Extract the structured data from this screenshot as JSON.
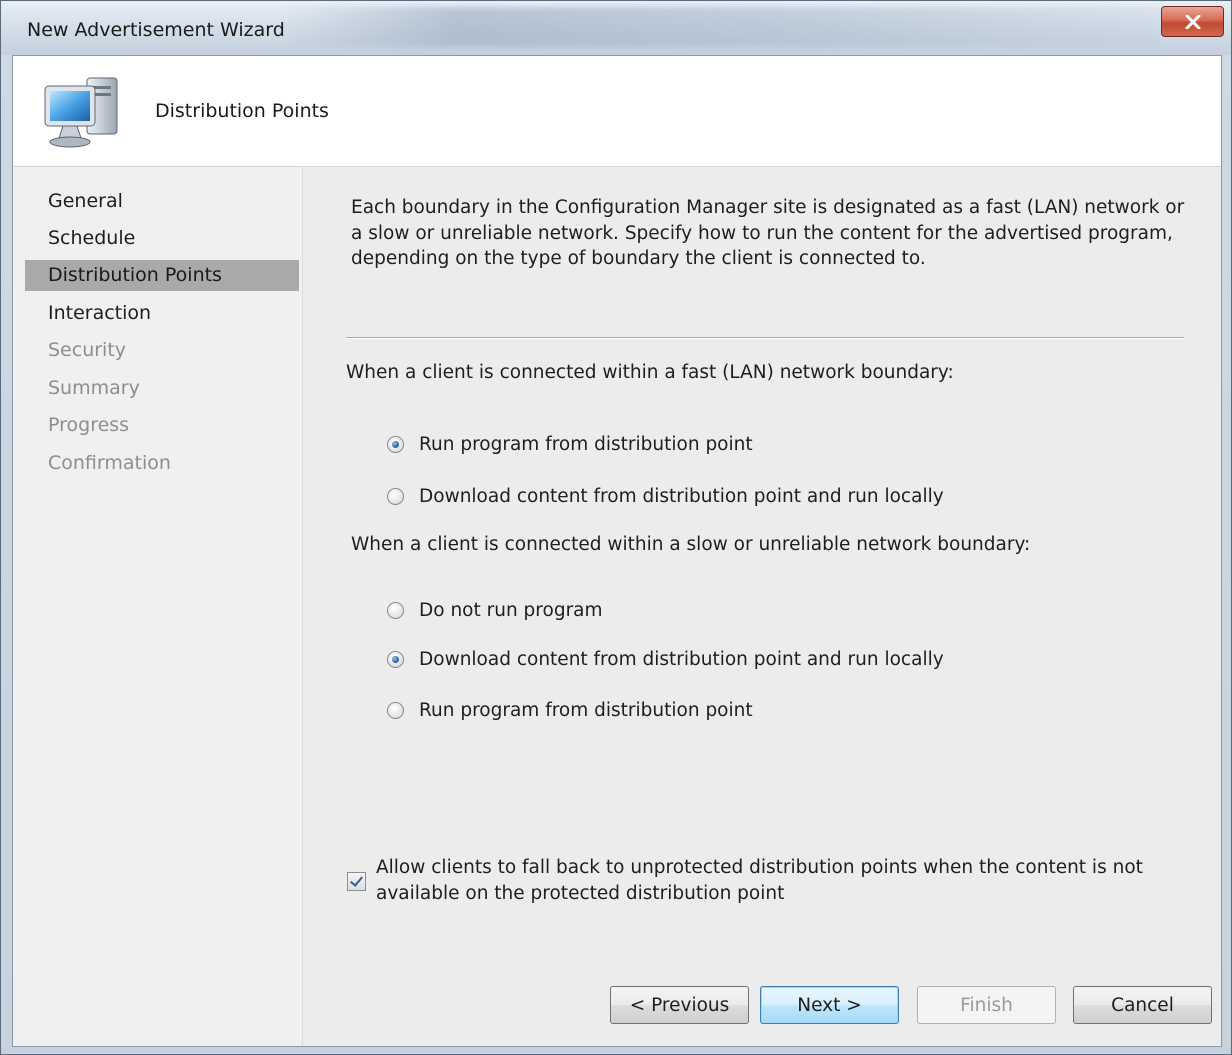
{
  "window": {
    "title": "New Advertisement Wizard"
  },
  "header": {
    "title": "Distribution Points",
    "icon": "computer-icon"
  },
  "nav": {
    "items": [
      {
        "label": "General",
        "state": "normal"
      },
      {
        "label": "Schedule",
        "state": "normal"
      },
      {
        "label": "Distribution Points",
        "state": "selected"
      },
      {
        "label": "Interaction",
        "state": "normal"
      },
      {
        "label": "Security",
        "state": "disabled"
      },
      {
        "label": "Summary",
        "state": "disabled"
      },
      {
        "label": "Progress",
        "state": "disabled"
      },
      {
        "label": "Confirmation",
        "state": "disabled"
      }
    ]
  },
  "content": {
    "description": "Each boundary in the Configuration Manager site is designated as a fast (LAN) network or a slow or unreliable network. Specify how to run the content for the advertised program, depending on the type of boundary the client is connected to.",
    "fast_group_label": "When a client is connected within a fast (LAN) network boundary:",
    "fast_options": [
      {
        "label": "Run program from distribution point",
        "checked": true
      },
      {
        "label": "Download content from distribution point and run locally",
        "checked": false
      }
    ],
    "slow_group_label": "When a client is connected within a slow or unreliable network boundary:",
    "slow_options": [
      {
        "label": "Do not run program",
        "checked": false
      },
      {
        "label": "Download content from distribution point and run locally",
        "checked": true
      },
      {
        "label": "Run program from distribution point",
        "checked": false
      }
    ],
    "fallback_checkbox": {
      "label": "Allow clients to fall back to unprotected distribution points when the content is not available on the protected distribution point",
      "checked": true
    }
  },
  "buttons": {
    "previous": "< Previous",
    "next": "Next >",
    "finish": "Finish",
    "cancel": "Cancel"
  },
  "colors": {
    "nav_selected": "#a9a9a9",
    "close_button": "#c04a33",
    "default_button_border": "#3c7fb1"
  }
}
